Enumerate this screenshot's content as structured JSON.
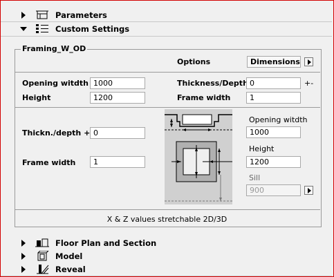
{
  "sections": {
    "parameters": "Parameters",
    "custom_settings": "Custom Settings",
    "floor_plan": "Floor Plan and Section",
    "model": "Model",
    "reveal": "Reveal"
  },
  "panel": {
    "title": "Framing_W_OD",
    "options_label": "Options",
    "dimensions_value": "Dimensions",
    "opening_width_label": "Opening witdth",
    "opening_width_value": "1000",
    "height_label": "Height",
    "height_value": "1200",
    "thickness_label": "Thickness/Depth",
    "thickness_value": "0",
    "thickness_suffix": "+-",
    "frame_width_label": "Frame width",
    "frame_width_value": "1",
    "thickn_depth_label": "Thickn./depth +-",
    "thickn_depth_value": "0",
    "frame_width2_label": "Frame width",
    "frame_width2_value": "1",
    "right_opening_label": "Opening witdth",
    "right_opening_value": "1000",
    "right_height_label": "Height",
    "right_height_value": "1200",
    "sill_label": "Sill",
    "sill_value": "900",
    "note": "X & Z values stretchable 2D/3D"
  },
  "icons": [
    "play-icon",
    "parameters-icon",
    "custom-settings-icon",
    "floor-plan-icon",
    "model-icon",
    "reveal-icon",
    "menu-arrow-icon"
  ],
  "colors": {
    "frame_border": "#d20000"
  }
}
